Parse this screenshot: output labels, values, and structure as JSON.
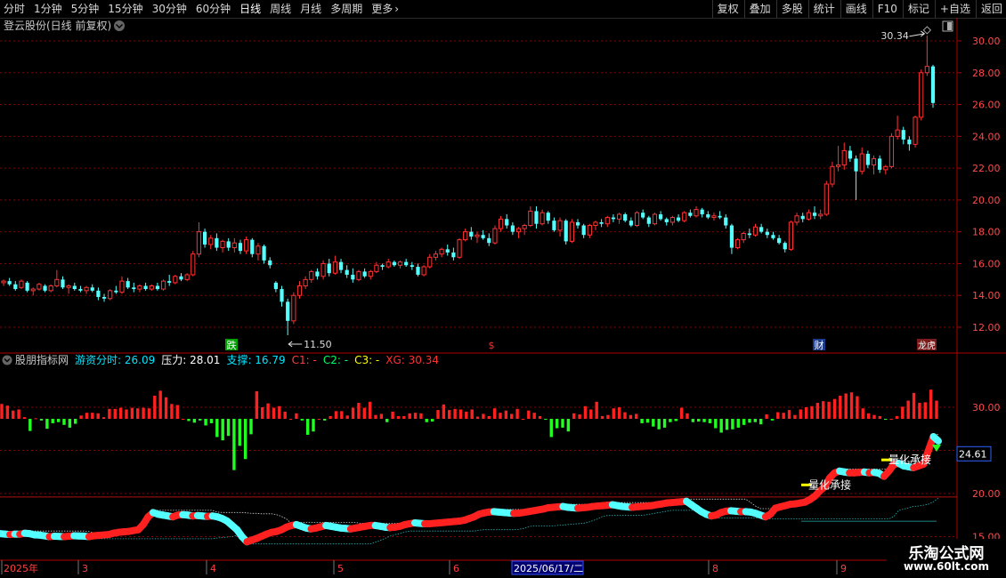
{
  "toolbar": {
    "left_items": [
      {
        "label": "分时",
        "active": false
      },
      {
        "label": "1分钟",
        "active": false
      },
      {
        "label": "5分钟",
        "active": false
      },
      {
        "label": "15分钟",
        "active": false
      },
      {
        "label": "30分钟",
        "active": false
      },
      {
        "label": "60分钟",
        "active": false
      },
      {
        "label": "日线",
        "active": true
      },
      {
        "label": "周线",
        "active": false
      },
      {
        "label": "月线",
        "active": false
      },
      {
        "label": "多周期",
        "active": false
      },
      {
        "label": "更多",
        "active": false
      }
    ],
    "right_items": [
      "复权",
      "叠加",
      "多股",
      "统计",
      "画线",
      "F10",
      "标记",
      "+自选",
      "返回"
    ]
  },
  "main_panel": {
    "title": "登云股份(日线 前复权)",
    "high_label": "30.34",
    "low_label": "11.50",
    "price_ticks": [
      "30.00",
      "28.00",
      "26.00",
      "24.00",
      "22.00",
      "20.00",
      "18.00",
      "16.00",
      "14.00",
      "12.00"
    ],
    "markers": [
      "跌",
      "$",
      "财",
      "龙虎"
    ]
  },
  "indicator_panel": {
    "name": "股朋指标网",
    "readouts": [
      {
        "label": "游资分时: 26.09",
        "color": "#00e5ff"
      },
      {
        "label": "压力: 28.01",
        "color": "#ffffff"
      },
      {
        "label": "支撑: 16.79",
        "color": "#00e5ff"
      },
      {
        "label": "C1: -",
        "color": "#ff4040"
      },
      {
        "label": "C2: -",
        "color": "#00ff66"
      },
      {
        "label": "C3: -",
        "color": "#ffff00"
      },
      {
        "label": "XG: 30.34",
        "color": "#ff3030"
      }
    ],
    "ticks": [
      "30.00",
      "20.00",
      "15.00"
    ],
    "current_value": "24.61",
    "annotation": "量化承接"
  },
  "time_axis": {
    "labels": [
      "2025年",
      "3",
      "4",
      "5",
      "6",
      "2025/06/17/二",
      "8",
      "9"
    ]
  },
  "watermark": {
    "line1": "乐淘公式网",
    "line2": "www.60lt.com"
  },
  "colors": {
    "up": "#ff3232",
    "down": "#54ffff",
    "grid": "#8b0000",
    "axis": "#b00000"
  },
  "chart_data": {
    "type": "candlestick",
    "ylim": [
      11,
      31
    ],
    "candles": [
      [
        14.8,
        15.0,
        14.6,
        14.9
      ],
      [
        14.9,
        15.1,
        14.6,
        14.7
      ],
      [
        14.7,
        14.9,
        14.3,
        14.4
      ],
      [
        14.5,
        15.0,
        14.4,
        14.9
      ],
      [
        14.8,
        14.9,
        14.2,
        14.3
      ],
      [
        14.3,
        14.5,
        14.0,
        14.4
      ],
      [
        14.4,
        14.8,
        14.3,
        14.7
      ],
      [
        14.6,
        14.7,
        14.2,
        14.3
      ],
      [
        14.3,
        14.7,
        14.2,
        14.6
      ],
      [
        14.6,
        15.6,
        14.5,
        15.0
      ],
      [
        15.0,
        15.2,
        14.4,
        14.5
      ],
      [
        14.5,
        14.7,
        14.1,
        14.6
      ],
      [
        14.6,
        14.8,
        14.3,
        14.4
      ],
      [
        14.4,
        14.6,
        14.2,
        14.3
      ],
      [
        14.3,
        14.6,
        14.1,
        14.5
      ],
      [
        14.5,
        14.7,
        14.2,
        14.3
      ],
      [
        14.3,
        14.5,
        13.7,
        13.9
      ],
      [
        13.9,
        14.1,
        13.6,
        13.8
      ],
      [
        13.8,
        14.4,
        13.7,
        14.3
      ],
      [
        14.3,
        14.6,
        14.1,
        14.2
      ],
      [
        14.2,
        15.2,
        14.1,
        14.9
      ],
      [
        14.9,
        15.1,
        14.4,
        14.5
      ],
      [
        14.5,
        14.8,
        14.2,
        14.4
      ],
      [
        14.4,
        14.7,
        14.2,
        14.6
      ],
      [
        14.6,
        14.8,
        14.3,
        14.4
      ],
      [
        14.4,
        14.7,
        14.3,
        14.6
      ],
      [
        14.6,
        14.8,
        14.3,
        14.4
      ],
      [
        14.4,
        15.0,
        14.3,
        14.9
      ],
      [
        14.9,
        15.3,
        14.6,
        14.8
      ],
      [
        14.8,
        15.3,
        14.7,
        15.2
      ],
      [
        15.2,
        15.4,
        14.9,
        15.0
      ],
      [
        15.0,
        15.4,
        14.9,
        15.3
      ],
      [
        15.3,
        16.8,
        15.2,
        16.6
      ],
      [
        16.6,
        18.6,
        16.4,
        18.0
      ],
      [
        18.0,
        18.2,
        17.0,
        17.2
      ],
      [
        17.2,
        17.8,
        16.9,
        17.6
      ],
      [
        17.6,
        17.9,
        16.8,
        17.0
      ],
      [
        17.0,
        17.5,
        16.7,
        17.4
      ],
      [
        17.4,
        17.6,
        16.8,
        17.0
      ],
      [
        17.0,
        17.6,
        16.7,
        17.3
      ],
      [
        17.3,
        17.5,
        16.6,
        16.8
      ],
      [
        16.8,
        17.7,
        16.6,
        17.5
      ],
      [
        17.5,
        17.6,
        16.4,
        16.6
      ],
      [
        16.6,
        17.3,
        16.2,
        17.1
      ],
      [
        17.1,
        17.2,
        16.0,
        16.2
      ],
      [
        16.2,
        16.4,
        15.7,
        15.9
      ],
      [
        14.8,
        14.9,
        14.2,
        14.4
      ],
      [
        14.4,
        14.6,
        13.3,
        13.6
      ],
      [
        13.6,
        13.8,
        11.5,
        12.4
      ],
      [
        12.4,
        14.2,
        12.2,
        14.0
      ],
      [
        14.0,
        14.9,
        13.8,
        14.6
      ],
      [
        14.6,
        15.2,
        14.4,
        15.0
      ],
      [
        15.0,
        15.6,
        14.8,
        15.5
      ],
      [
        15.5,
        15.7,
        15.0,
        15.2
      ],
      [
        15.2,
        16.2,
        15.0,
        16.0
      ],
      [
        16.0,
        16.3,
        15.2,
        15.4
      ],
      [
        15.4,
        16.5,
        15.3,
        16.1
      ],
      [
        16.1,
        16.3,
        15.4,
        15.6
      ],
      [
        15.6,
        15.9,
        15.1,
        15.3
      ],
      [
        15.3,
        15.7,
        14.8,
        15.0
      ],
      [
        15.0,
        15.6,
        14.9,
        15.5
      ],
      [
        15.5,
        15.7,
        15.1,
        15.2
      ],
      [
        15.2,
        15.6,
        15.0,
        15.5
      ],
      [
        15.5,
        16.1,
        15.4,
        15.9
      ],
      [
        15.9,
        16.0,
        15.6,
        15.8
      ],
      [
        15.8,
        16.3,
        15.7,
        16.1
      ],
      [
        16.1,
        16.2,
        15.8,
        15.9
      ],
      [
        15.9,
        16.2,
        15.7,
        16.1
      ],
      [
        16.1,
        16.3,
        15.8,
        15.9
      ],
      [
        15.9,
        16.1,
        15.6,
        15.8
      ],
      [
        15.8,
        16.0,
        15.2,
        15.3
      ],
      [
        15.3,
        15.9,
        15.2,
        15.8
      ],
      [
        15.8,
        16.6,
        15.7,
        16.4
      ],
      [
        16.4,
        16.8,
        16.2,
        16.6
      ],
      [
        16.6,
        17.0,
        16.4,
        16.9
      ],
      [
        16.9,
        17.2,
        16.5,
        16.7
      ],
      [
        16.7,
        17.0,
        16.2,
        16.4
      ],
      [
        16.4,
        17.6,
        16.3,
        17.5
      ],
      [
        17.5,
        18.2,
        17.4,
        18.0
      ],
      [
        18.0,
        18.3,
        17.5,
        17.7
      ],
      [
        17.7,
        18.0,
        17.3,
        17.8
      ],
      [
        17.8,
        18.1,
        17.5,
        17.6
      ],
      [
        17.6,
        17.9,
        17.1,
        17.3
      ],
      [
        17.3,
        18.4,
        17.2,
        18.2
      ],
      [
        18.2,
        19.0,
        18.0,
        18.8
      ],
      [
        18.8,
        19.1,
        18.2,
        18.4
      ],
      [
        18.4,
        18.6,
        17.8,
        18.0
      ],
      [
        18.0,
        18.3,
        17.6,
        18.2
      ],
      [
        18.2,
        18.5,
        17.8,
        18.4
      ],
      [
        18.4,
        19.6,
        18.3,
        19.3
      ],
      [
        19.3,
        19.6,
        18.2,
        18.5
      ],
      [
        18.5,
        19.4,
        18.4,
        19.2
      ],
      [
        19.2,
        19.3,
        18.5,
        18.7
      ],
      [
        18.7,
        18.9,
        18.0,
        18.1
      ],
      [
        18.1,
        18.9,
        17.7,
        18.7
      ],
      [
        18.7,
        18.8,
        17.2,
        17.4
      ],
      [
        17.4,
        18.8,
        17.3,
        18.6
      ],
      [
        18.6,
        18.8,
        18.2,
        18.4
      ],
      [
        18.4,
        18.5,
        17.6,
        17.8
      ],
      [
        17.8,
        18.5,
        17.6,
        18.4
      ],
      [
        18.4,
        18.7,
        18.1,
        18.6
      ],
      [
        18.6,
        18.8,
        18.3,
        18.5
      ],
      [
        18.5,
        19.0,
        18.3,
        18.9
      ],
      [
        18.9,
        19.1,
        18.6,
        18.8
      ],
      [
        18.8,
        19.2,
        18.5,
        19.1
      ],
      [
        19.1,
        19.2,
        18.6,
        18.7
      ],
      [
        18.7,
        18.9,
        18.3,
        18.4
      ],
      [
        18.4,
        19.3,
        18.3,
        19.2
      ],
      [
        19.2,
        19.4,
        18.8,
        18.9
      ],
      [
        18.9,
        19.0,
        18.3,
        18.5
      ],
      [
        18.5,
        19.2,
        18.4,
        19.1
      ],
      [
        19.1,
        19.3,
        18.7,
        18.8
      ],
      [
        18.8,
        18.9,
        18.4,
        18.6
      ],
      [
        18.6,
        19.0,
        18.4,
        18.9
      ],
      [
        18.9,
        19.1,
        18.6,
        18.7
      ],
      [
        18.7,
        19.3,
        18.6,
        19.2
      ],
      [
        19.2,
        19.4,
        18.9,
        19.0
      ],
      [
        19.0,
        19.6,
        18.9,
        19.4
      ],
      [
        19.4,
        19.5,
        18.9,
        19.1
      ],
      [
        19.1,
        19.3,
        18.8,
        18.9
      ],
      [
        18.9,
        19.2,
        18.7,
        19.0
      ],
      [
        19.0,
        19.3,
        18.8,
        18.9
      ],
      [
        18.9,
        19.1,
        18.2,
        18.4
      ],
      [
        18.4,
        18.5,
        16.6,
        17.0
      ],
      [
        17.0,
        17.6,
        16.9,
        17.5
      ],
      [
        17.5,
        18.0,
        17.3,
        17.9
      ],
      [
        17.9,
        18.2,
        17.6,
        17.8
      ],
      [
        17.8,
        18.5,
        17.7,
        18.3
      ],
      [
        18.3,
        18.5,
        17.9,
        18.0
      ],
      [
        18.0,
        18.2,
        17.6,
        17.8
      ],
      [
        17.8,
        18.0,
        17.5,
        17.6
      ],
      [
        17.6,
        17.8,
        17.2,
        17.3
      ],
      [
        17.3,
        17.4,
        16.7,
        16.9
      ],
      [
        16.9,
        18.7,
        16.8,
        18.6
      ],
      [
        18.6,
        19.2,
        18.4,
        19.0
      ],
      [
        19.0,
        19.2,
        18.6,
        18.8
      ],
      [
        18.8,
        19.4,
        18.7,
        19.2
      ],
      [
        19.2,
        19.6,
        18.8,
        19.0
      ],
      [
        19.0,
        19.4,
        18.8,
        19.1
      ],
      [
        19.1,
        21.2,
        19.0,
        21.0
      ],
      [
        21.0,
        22.4,
        20.8,
        22.1
      ],
      [
        22.1,
        23.4,
        21.8,
        22.2
      ],
      [
        22.2,
        23.6,
        21.9,
        23.1
      ],
      [
        23.1,
        23.4,
        22.4,
        22.6
      ],
      [
        22.6,
        22.8,
        20.0,
        21.8
      ],
      [
        21.8,
        23.3,
        21.6,
        22.9
      ],
      [
        22.9,
        23.1,
        22.0,
        22.2
      ],
      [
        22.2,
        22.8,
        21.6,
        22.6
      ],
      [
        22.6,
        22.8,
        21.7,
        21.9
      ],
      [
        21.9,
        22.2,
        21.6,
        22.1
      ],
      [
        22.1,
        24.2,
        22.0,
        24.0
      ],
      [
        24.0,
        25.3,
        23.8,
        24.4
      ],
      [
        24.4,
        24.6,
        23.5,
        23.8
      ],
      [
        23.8,
        24.0,
        23.1,
        23.5
      ],
      [
        23.5,
        25.3,
        23.3,
        25.2
      ],
      [
        25.2,
        28.2,
        25.0,
        28.0
      ],
      [
        28.0,
        30.34,
        27.8,
        28.4
      ],
      [
        28.4,
        28.5,
        25.8,
        26.1
      ]
    ],
    "indicator_bars": [
      27,
      24,
      15,
      17,
      3,
      -22,
      1,
      -3,
      -18,
      -8,
      -6,
      -11,
      -16,
      -9,
      6,
      11,
      11,
      10,
      3,
      18,
      18,
      20,
      17,
      20,
      19,
      20,
      19,
      42,
      51,
      39,
      27,
      25,
      0,
      -4,
      -7,
      -3,
      -12,
      -8,
      -33,
      -39,
      -31,
      -93,
      -49,
      -73,
      -28,
      50,
      21,
      28,
      20,
      23,
      13,
      0,
      10,
      -3,
      -29,
      -23,
      0,
      -3,
      5,
      14,
      14,
      6,
      20,
      29,
      20,
      31,
      7,
      9,
      -6,
      13,
      5,
      5,
      10,
      11,
      10,
      -6,
      -5,
      16,
      26,
      16,
      18,
      17,
      13,
      17,
      4,
      9,
      5,
      19,
      11,
      15,
      9,
      18,
      0,
      15,
      11,
      5,
      -1,
      -33,
      -17,
      -16,
      -23,
      10,
      8,
      23,
      17,
      31,
      5,
      7,
      19,
      21,
      12,
      7,
      9,
      -8,
      -7,
      -14,
      -19,
      -16,
      -6,
      -4,
      20,
      10,
      -6,
      -5,
      -6,
      -8,
      -17,
      -25,
      -20,
      -19,
      -16,
      -11,
      -7,
      -6,
      -10,
      8,
      -3,
      12,
      11,
      16,
      7,
      17,
      21,
      23,
      29,
      32,
      31,
      36,
      42,
      46,
      48,
      41,
      19,
      10,
      7,
      5,
      -1,
      0,
      5,
      22,
      33,
      47,
      29,
      30,
      53,
      33
    ],
    "main_line": [
      15.35,
      15.3,
      15.25,
      15.3,
      15.28,
      15.4,
      15.35,
      15.2,
      15.18,
      15.1,
      15.0,
      15.05,
      15.02,
      15.0,
      15.05,
      15.1,
      15.08,
      15.06,
      15.0,
      15.1,
      15.15,
      15.2,
      15.25,
      15.4,
      15.5,
      15.55,
      15.6,
      15.7,
      15.8,
      16.4,
      17.3,
      17.8,
      17.6,
      17.5,
      17.4,
      17.3,
      17.5,
      17.55,
      17.5,
      17.4,
      17.45,
      17.4,
      17.35,
      17.4,
      17.3,
      17.1,
      16.8,
      16.3,
      15.8,
      15.0,
      14.4,
      14.6,
      14.8,
      15.05,
      15.3,
      15.5,
      15.6,
      15.8,
      16.1,
      16.3,
      16.4,
      16.2,
      16.0,
      15.9,
      16.0,
      16.15,
      16.3,
      16.2,
      16.1,
      16.0,
      15.95,
      15.9,
      16.0,
      16.1,
      16.2,
      16.3,
      16.3,
      16.2,
      16.1,
      16.05,
      16.1,
      16.2,
      16.4,
      16.5,
      16.6,
      16.55,
      16.5,
      16.5,
      16.55,
      16.6,
      16.65,
      16.7,
      16.75,
      16.8,
      16.9,
      17.1,
      17.3,
      17.6,
      17.75,
      17.85,
      17.9,
      17.85,
      17.8,
      17.75,
      17.7,
      17.72,
      17.8,
      17.9,
      18.0,
      18.1,
      18.2,
      18.35,
      18.4,
      18.45,
      18.5,
      18.4,
      18.35,
      18.3,
      18.35,
      18.4,
      18.5,
      18.55,
      18.6,
      18.65,
      18.7,
      18.6,
      18.5,
      18.45,
      18.4,
      18.45,
      18.5,
      18.55,
      18.6,
      18.7,
      18.8,
      18.9,
      18.95,
      19.0,
      19.05,
      19.1,
      18.7,
      18.3,
      17.9,
      17.6,
      17.4,
      17.5,
      17.8,
      17.95,
      18.0,
      17.95,
      17.9,
      17.9,
      17.85,
      17.7,
      17.5,
      17.3,
      17.6,
      18.3,
      18.45,
      18.6,
      18.75,
      18.8,
      18.9,
      19.0,
      19.3,
      19.7,
      20.3,
      20.8,
      21.8,
      22.4,
      22.6,
      22.5,
      22.4,
      22.4,
      22.45,
      22.5,
      22.4,
      22.45,
      22.35,
      22.0,
      22.6,
      23.4,
      23.5,
      23.2,
      23.1,
      23.0,
      23.2,
      23.4,
      25.0,
      26.6,
      26.09
    ]
  }
}
